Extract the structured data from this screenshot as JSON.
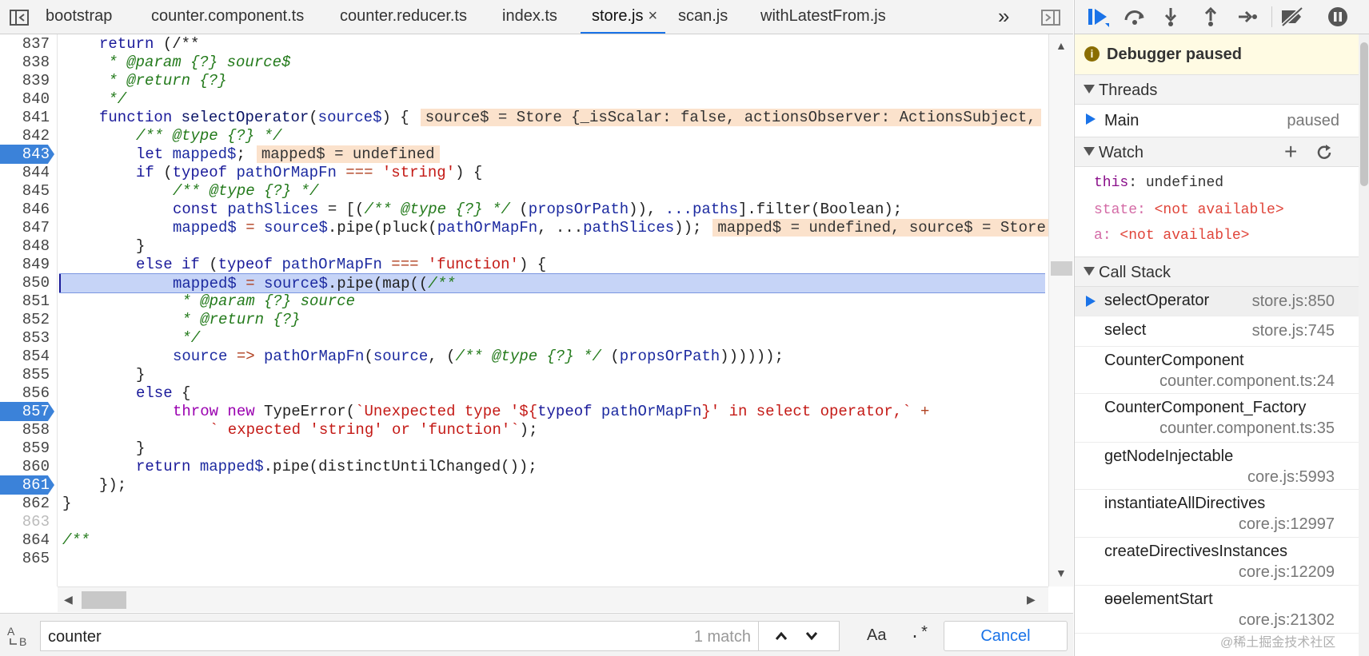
{
  "tabs": [
    {
      "label": "bootstrap",
      "active": false
    },
    {
      "label": "counter.component.ts",
      "active": false
    },
    {
      "label": "counter.reducer.ts",
      "active": false
    },
    {
      "label": "index.ts",
      "active": false
    },
    {
      "label": "store.js",
      "active": true,
      "close": "×"
    },
    {
      "label": "scan.js",
      "active": false
    },
    {
      "label": "withLatestFrom.js",
      "active": false
    }
  ],
  "tabbar": {
    "more_glyph": "»"
  },
  "editor": {
    "line_numbers": [
      "837",
      "838",
      "839",
      "840",
      "841",
      "842",
      "843",
      "844",
      "845",
      "846",
      "847",
      "848",
      "849",
      "850",
      "851",
      "852",
      "853",
      "854",
      "855",
      "856",
      "857",
      "858",
      "859",
      "860",
      "861",
      "862",
      "863",
      "864",
      "865"
    ],
    "breakpoint_lines": [
      "843",
      "857",
      "861"
    ],
    "current_line": "850",
    "inline_values": {
      "l841": "source$ = Store {_isScalar: false, actionsObserver: ActionsSubject,",
      "l843": "mapped$ = undefined",
      "l847": "mapped$ = undefined, source$ = Store"
    },
    "tokens": {
      "l837_a": "return",
      "l837_b": "(/**",
      "l838": " * @param {?} source$",
      "l839": " * @return {?}",
      "l840": " */",
      "l841_a": "function",
      "l841_b": "selectOperator",
      "l841_c": "(",
      "l841_d": "source$",
      "l841_e": ") {",
      "l842": "/** @type {?} */",
      "l843_a": "let",
      "l843_b": "mapped$",
      "l843_c": ";",
      "l844_a": "if",
      "l844_b": " (",
      "l844_c": "typeof",
      "l844_d": "pathOrMapFn",
      "l844_e": " === ",
      "l844_f": "'string'",
      "l844_g": ") {",
      "l845": "/** @type {?} */",
      "l846_a": "const",
      "l846_b": "pathSlices",
      "l846_c": " = [(",
      "l846_d": "/** @type {?} */",
      "l846_e": " (",
      "l846_f": "propsOrPath",
      "l846_g": ")), ",
      "l846_h": "...paths",
      "l846_i": "].filter(Boolean);",
      "l847_a": "mapped$",
      "l847_b": " = ",
      "l847_c": "source$",
      "l847_d": ".pipe(pluck(",
      "l847_e": "pathOrMapFn",
      "l847_f": ", ...",
      "l847_g": "pathSlices",
      "l847_h": "));",
      "l848": "}",
      "l849_a": "else if",
      "l849_b": " (",
      "l849_c": "typeof",
      "l849_d": "pathOrMapFn",
      "l849_e": " === ",
      "l849_f": "'function'",
      "l849_g": ") {",
      "l850_a": "mapped$",
      "l850_b": " = ",
      "l850_c": "source$",
      "l850_d": ".pipe(map((",
      "l850_e": "/**",
      "l851": " * @param {?} source",
      "l852": " * @return {?}",
      "l853": " */",
      "l854_a": "source",
      "l854_b": " => ",
      "l854_c": "pathOrMapFn",
      "l854_d": "(",
      "l854_e": "source",
      "l854_f": ", (",
      "l854_g": "/** @type {?} */",
      "l854_h": " (",
      "l854_i": "propsOrPath",
      "l854_j": "))))));",
      "l855": "}",
      "l856_a": "else",
      "l856_b": " {",
      "l857_a": "throw",
      "l857_b": " ",
      "l857_c": "new",
      "l857_d": " TypeError(",
      "l857_e": "`Unexpected type '${",
      "l857_f": "typeof",
      "l857_g": " pathOrMapFn",
      "l857_h": "}' in select operator,`",
      "l857_i": " +",
      "l858": "` expected 'string' or 'function'`",
      "l858_end": ");",
      "l859": "}",
      "l860_a": "return",
      "l860_b": " ",
      "l860_c": "mapped$",
      "l860_d": ".pipe(distinctUntilChanged());",
      "l861": "});",
      "l862": "}",
      "l864": "/**"
    }
  },
  "search": {
    "query": "counter",
    "match_count": "1 match",
    "case_label": "Aa",
    "regex_label": ".*",
    "cancel_label": "Cancel"
  },
  "sidebar": {
    "paused_title": "Debugger paused",
    "paused_icon": "info-icon",
    "threads": {
      "title": "Threads",
      "rows": [
        {
          "name": "Main",
          "state": "paused"
        }
      ]
    },
    "watch": {
      "title": "Watch",
      "add": "+",
      "items": [
        {
          "key": "this",
          "value": "undefined"
        },
        {
          "key": "state",
          "value": "<not available>"
        },
        {
          "key": "a",
          "value": "<not available>"
        }
      ]
    },
    "call_stack": {
      "title": "Call Stack",
      "frames": [
        {
          "fn": "selectOperator",
          "loc": "store.js:850"
        },
        {
          "fn": "select",
          "loc": "store.js:745"
        },
        {
          "fn": "CounterComponent",
          "loc": "counter.component.ts:24"
        },
        {
          "fn": "CounterComponent_Factory",
          "loc": "counter.component.ts:35"
        },
        {
          "fn": "getNodeInjectable",
          "loc": "core.js:5993"
        },
        {
          "fn": "instantiateAllDirectives",
          "loc": "core.js:12997"
        },
        {
          "fn": "createDirectivesInstances",
          "loc": "core.js:12209"
        },
        {
          "fn": "ɵɵelementStart",
          "loc": "core.js:21302"
        }
      ]
    }
  },
  "watermark": "@稀土掘金技术社区",
  "colors": {
    "accent": "#1a73e8",
    "breakpoint": "#3b82d9",
    "exec_line": "#c6d4f7",
    "inline_value": "#fbe2cc",
    "paused_banner": "#fffbe3"
  }
}
